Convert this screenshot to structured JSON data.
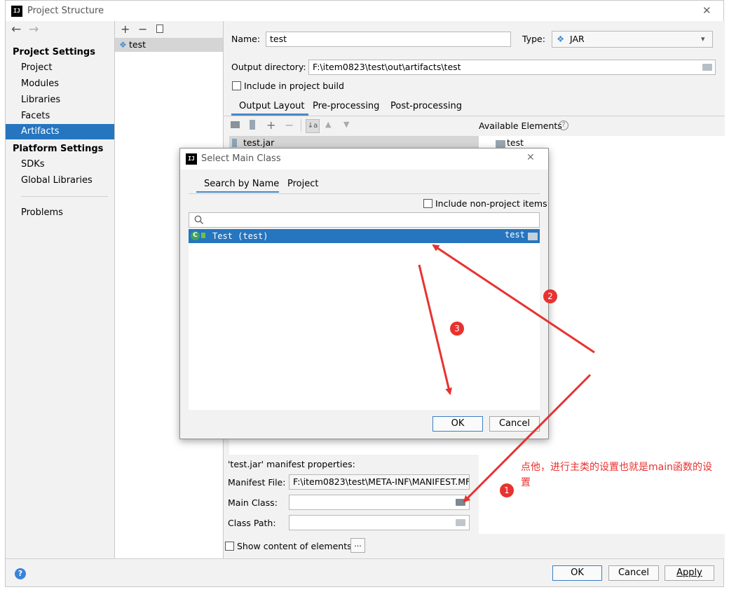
{
  "window": {
    "title": "Project Structure",
    "close_glyph": "✕"
  },
  "nav": {
    "back_glyph": "←",
    "forward_glyph": "→",
    "project_settings_header": "Project Settings",
    "project_settings_items": [
      "Project",
      "Modules",
      "Libraries",
      "Facets",
      "Artifacts"
    ],
    "platform_settings_header": "Platform Settings",
    "platform_settings_items": [
      "SDKs",
      "Global Libraries"
    ],
    "problems": "Problems",
    "selected": "Artifacts"
  },
  "artifacts_list": {
    "toolbar": [
      "+",
      "−",
      "copy"
    ],
    "items": [
      "test"
    ]
  },
  "artifact": {
    "name_label": "Name:",
    "name_value": "test",
    "type_label": "Type:",
    "type_value": "JAR",
    "output_dir_label": "Output directory:",
    "output_dir_value": "F:\\item0823\\test\\out\\artifacts\\test",
    "include_build_label": "Include in project build",
    "tabs": [
      "Output Layout",
      "Pre-processing",
      "Post-processing"
    ],
    "available_elements_label": "Available Elements",
    "available_help": "?",
    "layout_root": "test.jar",
    "available_items": [
      "test"
    ]
  },
  "manifest": {
    "header": "'test.jar' manifest properties:",
    "file_label": "Manifest File:",
    "file_value": "F:\\item0823\\test\\META-INF\\MANIFEST.MF",
    "main_class_label": "Main Class:",
    "main_class_value": "",
    "class_path_label": "Class Path:",
    "class_path_value": "",
    "show_content_label": "Show content of elements",
    "more_button": "..."
  },
  "footer": {
    "help": "?",
    "ok": "OK",
    "cancel": "Cancel",
    "apply": "Apply"
  },
  "dialog": {
    "title": "Select Main Class",
    "close_glyph": "✕",
    "tabs": [
      "Search by Name",
      "Project"
    ],
    "include_non_project": "Include non-project items",
    "search_placeholder": "",
    "results": [
      {
        "name": "Test (test)",
        "module": "test"
      }
    ],
    "ok": "OK",
    "cancel": "Cancel"
  },
  "annotations": {
    "badges": [
      "1",
      "2",
      "3"
    ],
    "note": "点他，进行主类的设置也就是main函数的设置",
    "color": "#e8322f"
  },
  "colors": {
    "selection": "#2675bf",
    "panel": "#f2f2f2",
    "accent_red": "#e8322f",
    "default_button_border": "#3b7fc4"
  }
}
